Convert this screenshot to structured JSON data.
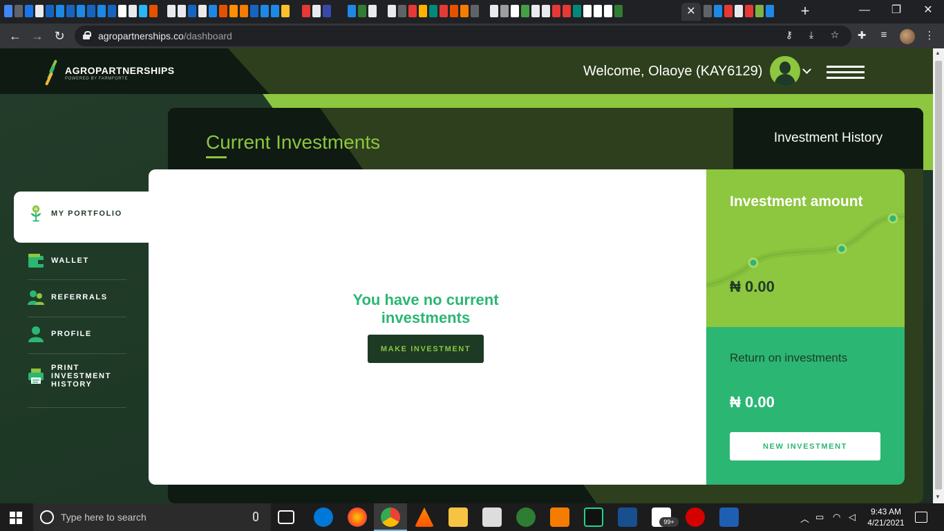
{
  "browser": {
    "url_host": "agropartnerships.co",
    "url_path": "/dashboard",
    "tab_close": "✕",
    "new_tab": "+",
    "back": "←",
    "forward": "→",
    "reload": "↻",
    "minimize": "—",
    "restore": "❐",
    "close": "✕"
  },
  "brand": {
    "name": "AGROPARTNERSHIPS",
    "tagline": "POWERED BY FARMFORTE",
    "colors": {
      "dark": "#0f1a12",
      "forest": "#1f3a27",
      "lime": "#8dc63f",
      "green": "#2bb673"
    }
  },
  "header": {
    "welcome": "Welcome, Olaoye (KAY6129)",
    "avatar_icon": "user-avatar-icon",
    "menu_icon": "hamburger-icon"
  },
  "sidebar": {
    "items": [
      {
        "label": "MY PORTFOLIO",
        "icon": "plant-icon",
        "active": true
      },
      {
        "label": "WALLET",
        "icon": "wallet-icon",
        "active": false
      },
      {
        "label": "REFERRALS",
        "icon": "users-icon",
        "active": false
      },
      {
        "label": "PROFILE",
        "icon": "person-icon",
        "active": false
      },
      {
        "label": "PRINT INVESTMENT HISTORY",
        "icon": "printer-icon",
        "active": false
      }
    ]
  },
  "main": {
    "title": "Current Investments",
    "history_tab": "Investment History",
    "empty_message": "You have no current investments",
    "make_investment": "MAKE INVESTMENT"
  },
  "summary": {
    "amount_label": "Investment amount",
    "amount_value": "₦ 0.00",
    "return_label": "Return on investments",
    "return_value": "₦ 0.00",
    "new_investment": "NEW INVESTMENT"
  },
  "taskbar": {
    "search_placeholder": "Type here to search",
    "time": "9:43 AM",
    "date": "4/21/2021",
    "badge": "99+"
  }
}
